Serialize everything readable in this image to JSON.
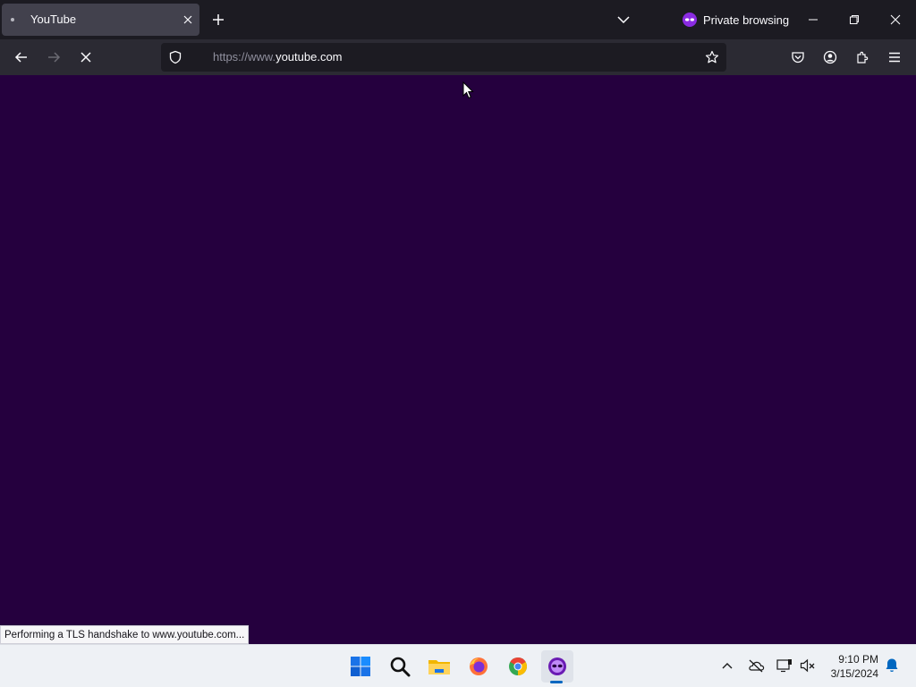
{
  "tab": {
    "title": "YouTube"
  },
  "private_browsing": {
    "label": "Private browsing"
  },
  "url": {
    "prefix": "https://www.",
    "domain": "youtube.com"
  },
  "status_text": "Performing a TLS handshake to www.youtube.com...",
  "clock": {
    "time": "9:10 PM",
    "date": "3/15/2024"
  },
  "colors": {
    "page_background": "#25003e",
    "private_accent": "#8a2be2"
  },
  "icons": {
    "navigation": [
      "back-icon",
      "forward-icon",
      "stop-icon"
    ],
    "toolbar": [
      "pocket-icon",
      "account-icon",
      "extensions-icon",
      "menu-icon"
    ],
    "taskbar": [
      "windows-start-icon",
      "search-icon",
      "file-explorer-icon",
      "firefox-icon",
      "chrome-icon",
      "firefox-private-icon"
    ],
    "tray": [
      "chevron-up-icon",
      "onedrive-off-icon",
      "display-icon",
      "volume-muted-icon",
      "notification-bell-icon"
    ]
  }
}
